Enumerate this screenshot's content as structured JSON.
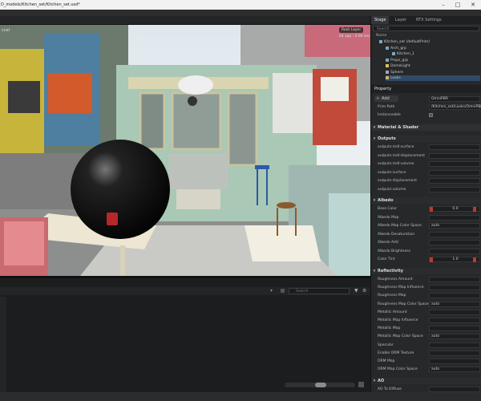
{
  "window": {
    "title": "D_models/Kitchen_set/Kitchen_set.usd*"
  },
  "viewport": {
    "camera_label": "ccel",
    "root_layer_button": "Root Layer",
    "stats": "64 spp : 0.60 sec"
  },
  "bottom_panel": {
    "search_placeholder": "Search"
  },
  "stage_panel": {
    "tabs": [
      "Stage",
      "Layer",
      "RTX Settings"
    ],
    "search_placeholder": "Search",
    "column_name": "Name",
    "tree": [
      {
        "label": "Kitchen_set (defaultPrim)",
        "depth": 0
      },
      {
        "label": "Arch_grp",
        "depth": 1
      },
      {
        "label": "Kitchen_1",
        "depth": 2
      },
      {
        "label": "Props_grp",
        "depth": 1
      },
      {
        "label": "DomeLight",
        "depth": 1
      },
      {
        "label": "Sphere",
        "depth": 1
      },
      {
        "label": "Looks",
        "depth": 1
      }
    ]
  },
  "property_panel": {
    "title": "Property",
    "add_button": "Add",
    "add_value": "OmniPBR",
    "prim_path_label": "Prim Path",
    "prim_path_value": "/Kitchen_set/Looks/OmniPBR",
    "instanceable_label": "Instanceable",
    "material_section": "Material & Shader",
    "outputs_section": "Outputs",
    "outputs": [
      "outputs:mdl:surface",
      "outputs:mdl:displacement",
      "outputs:mdl:volume",
      "outputs:surface",
      "outputs:displacement",
      "outputs:volume"
    ],
    "albedo_section": "Albedo",
    "albedo": [
      {
        "label": "Base Color",
        "value": "0.0"
      },
      {
        "label": "Albedo Map",
        "value": ""
      },
      {
        "label": "Albedo Map Color Space",
        "value": "auto"
      },
      {
        "label": "Albedo Desaturation",
        "value": ""
      },
      {
        "label": "Albedo Add",
        "value": ""
      },
      {
        "label": "Albedo Brightness",
        "value": ""
      },
      {
        "label": "Color Tint",
        "value": "1.0"
      }
    ],
    "reflectivity_section": "Reflectivity",
    "reflectivity": [
      {
        "label": "Roughness Amount",
        "value": ""
      },
      {
        "label": "Roughness Map Influence",
        "value": ""
      },
      {
        "label": "Roughness Map",
        "value": ""
      },
      {
        "label": "Roughness Map Color Space",
        "value": "auto"
      },
      {
        "label": "Metallic Amount",
        "value": ""
      },
      {
        "label": "Metallic Map Influence",
        "value": ""
      },
      {
        "label": "Metallic Map",
        "value": ""
      },
      {
        "label": "Metallic Map Color Space",
        "value": "auto"
      },
      {
        "label": "Specular",
        "value": ""
      },
      {
        "label": "Enable ORM Texture",
        "value": ""
      },
      {
        "label": "ORM Map",
        "value": ""
      },
      {
        "label": "ORM Map Color Space",
        "value": "auto"
      }
    ],
    "ao_section": "AO",
    "ao": [
      {
        "label": "AO To Diffuse",
        "value": ""
      }
    ]
  }
}
